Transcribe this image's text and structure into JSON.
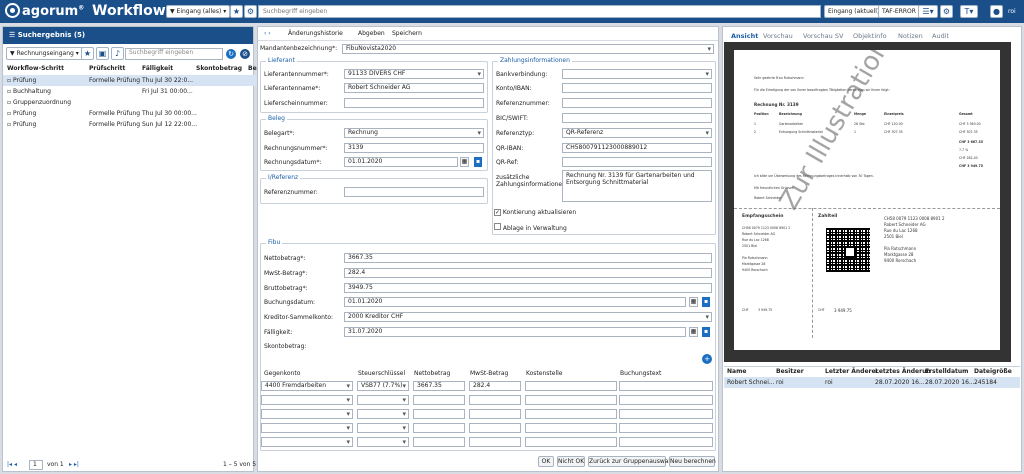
{
  "app": {
    "logo": "agorum",
    "title": "Workflow"
  },
  "topbar": {
    "eingang_alles": "Eingang (alles)",
    "search_placeholder": "Suchbegriff eingeben",
    "eingang_aktuell": "Eingang (aktuell)",
    "taf_error": "TAF-ERROR",
    "user": "roi"
  },
  "left": {
    "title": "Suchergebnis (5)",
    "filter": "Rechnungseingang",
    "search_placeholder": "Suchbegriff eingeben",
    "columns": [
      "Workflow-Schritt",
      "Prüfschritt",
      "Fälligkeit",
      "Skontobetrag",
      "Be"
    ],
    "rows": [
      {
        "schritt": "Prüfung",
        "pruef": "Formelle Prüfung",
        "faellig": "Thu Jul 30 22:0..."
      },
      {
        "schritt": "Buchhaltung",
        "pruef": "",
        "faellig": "Fri Jul 31 00:00..."
      },
      {
        "schritt": "Gruppenzuordnung",
        "pruef": "",
        "faellig": ""
      },
      {
        "schritt": "Prüfung",
        "pruef": "Formelle Prüfung",
        "faellig": "Thu Jul 30 00:00..."
      },
      {
        "schritt": "Prüfung",
        "pruef": "Formelle Prüfung",
        "faellig": "Sun Jul 12 22:00..."
      }
    ],
    "pager": {
      "page": "1",
      "of": "von 1",
      "range": "1 – 5 von 5"
    }
  },
  "form": {
    "toolbar": [
      "Änderungshistorie",
      "Abgeben",
      "Speichern"
    ],
    "mandant_label": "Mandantenbezeichnung*:",
    "mandant": "FibuNovista2020",
    "lieferant_title": "Lieferant",
    "lnr_label": "Lieferantennummer*:",
    "lnr": "91133 DIVERS CHF",
    "lname_label": "Lieferantenname*:",
    "lname": "Robert Schneider AG",
    "lschein_label": "Lieferscheinnummer:",
    "beleg_title": "Beleg",
    "belegart_label": "Belegart*:",
    "belegart": "Rechnung",
    "rnr_label": "Rechnungsnummer*:",
    "rnr": "3139",
    "rdat_label": "Rechnungsdatum*:",
    "rdat": "01.01.2020",
    "iref_title": "I/Referenz",
    "ref_label": "Referenznummer:",
    "zahl_title": "Zahlungsinformationen",
    "bank_label": "Bankverbindung:",
    "konto_label": "Konto/IBAN:",
    "refnr_label": "Referenznummer:",
    "bic_label": "BIC/SWIFT:",
    "reftyp_label": "Referenztyp:",
    "reftyp": "QR-Referenz",
    "qriban_label": "QR-IBAN:",
    "qriban": "CH5800791123000889012",
    "qrref_label": "QR-Ref:",
    "zus_label": "zusätzliche Zahlungsinformationen:",
    "zus": "Rechnung Nr. 3139 für Gartenarbeiten und Entsorgung Schnittmaterial",
    "chk1": "Kontierung aktualisieren",
    "chk2": "Ablage in Verwaltung",
    "fibu_title": "Fibu",
    "netto_label": "Nettobetrag*:",
    "netto": "3667.35",
    "mwst_label": "MwSt-Betrag*:",
    "mwst": "282.4",
    "brutto_label": "Bruttobetrag*:",
    "brutto": "3949.75",
    "buch_label": "Buchungsdatum:",
    "buch": "01.01.2020",
    "kred_label": "Kreditor-Sammelkonto:",
    "kred": "2000 Kreditor CHF",
    "faell_label": "Fälligkeit:",
    "faell": "31.07.2020",
    "skonto_label": "Skontobetrag:",
    "grid_cols": [
      "Gegenkonto",
      "Steuerschlüssel",
      "Nettobetrag",
      "MwSt-Betrag",
      "Kostenstelle",
      "Buchungstext"
    ],
    "grid_row": [
      "4400 Fremdarbeiten",
      "VSB77 (7.7%)",
      "3667.35",
      "282.4",
      "",
      ""
    ],
    "buttons": [
      "OK",
      "Nicht OK",
      "Zurück zur Gruppenauswahl",
      "Neu berechnen"
    ]
  },
  "right": {
    "tabs": [
      "Ansicht",
      "Vorschau",
      "Vorschau SV",
      "Objektinfo",
      "Notizen",
      "Audit"
    ],
    "doc": {
      "watermark": "Zur Illustration",
      "greeting": "Sehr geehrte Frau Rutschmann",
      "intro": "Für die Erledigung der von Ihnen beauftragten Tätigkeiten berechnen wir Ihnen folgt:",
      "rechnung": "Rechnung Nr. 3139",
      "cols": [
        "Position",
        "Bezeichnung",
        "Menge",
        "Einzelpreis",
        "Gesamt"
      ],
      "pos1": [
        "1",
        "Gartenarbeiten",
        "26 Std.",
        "CHF 120.00",
        "CHF 3 360.00"
      ],
      "pos2": [
        "2",
        "Entsorgung Schnittmaterial",
        "1",
        "CHF 307.35",
        "CHF 307.35"
      ],
      "summe": "CHF 3 667.35",
      "mwst": "7.7 %",
      "mwstbetrag": "CHF 282.40",
      "total": "CHF 3 949.75",
      "footer1": "Ich bitte um Überweisung des Rechnungsbetrages innerhalb von 30 Tagen.",
      "gruss": "Mit freundlichen Grüssen",
      "sign": "Robert Schneider",
      "empfang": "Empfangsschein",
      "zahlteil": "Zahlteil",
      "konto": "CH58 0079 1123 0008 8901 2",
      "name": "Robert Schneider AG",
      "strasse": "Rue du Lac 1268",
      "ort": "2501 Biel",
      "zahler": "Pia Rutschmann",
      "zstr": "Marktgasse 28",
      "zort": "9400 Rorschach",
      "betrag": "3 949.75",
      "waehrung": "CHF"
    },
    "grid_cols": [
      "Name",
      "Besitzer",
      "Letzter Änderer",
      "Letztes Änderun",
      "Erstelldatum",
      "Dateigröße"
    ],
    "grid_row": [
      "Robert Schnei...",
      "roi",
      "roi",
      "28.07.2020 16...",
      "28.07.2020 16...",
      "245184"
    ]
  }
}
